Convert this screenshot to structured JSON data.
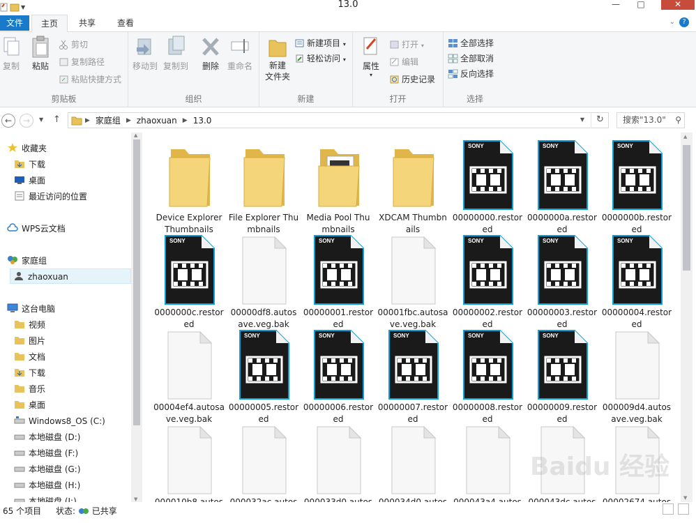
{
  "window": {
    "title": "13.0"
  },
  "tabs": [
    {
      "label": "文件"
    },
    {
      "label": "主页"
    },
    {
      "label": "共享"
    },
    {
      "label": "查看"
    }
  ],
  "ribbon": {
    "clipboard": {
      "label": "剪贴板",
      "copy": "复制",
      "paste": "粘贴",
      "cut": "剪切",
      "copy_path": "复制路径",
      "paste_shortcut": "粘贴快捷方式"
    },
    "organize": {
      "label": "组织",
      "move_to": "移动到",
      "copy_to": "复制到",
      "delete": "删除",
      "rename": "重命名"
    },
    "new": {
      "label": "新建",
      "new_folder": "新建\n文件夹",
      "new_item": "新建项目",
      "easy_access": "轻松访问"
    },
    "open": {
      "label": "打开",
      "properties": "属性",
      "open": "打开",
      "edit": "编辑",
      "history": "历史记录"
    },
    "select": {
      "label": "选择",
      "select_all": "全部选择",
      "select_none": "全部取消",
      "invert": "反向选择"
    }
  },
  "address": {
    "crumbs": [
      "家庭组",
      "zhaoxuan",
      "13.0"
    ],
    "search_placeholder": "搜索\"13.0\""
  },
  "nav": {
    "items": [
      {
        "label": "收藏夹",
        "icon": "star-icon"
      },
      {
        "label": "下载",
        "icon": "folder-download-icon"
      },
      {
        "label": "桌面",
        "icon": "desktop-icon"
      },
      {
        "label": "最近访问的位置",
        "icon": "recent-icon"
      },
      {
        "label": "WPS云文档",
        "icon": "cloud-icon"
      },
      {
        "label": "家庭组",
        "icon": "homegroup-icon"
      },
      {
        "label": "zhaoxuan",
        "icon": "user-icon"
      },
      {
        "label": "这台电脑",
        "icon": "computer-icon"
      },
      {
        "label": "视频",
        "icon": "folder-icon"
      },
      {
        "label": "图片",
        "icon": "folder-icon"
      },
      {
        "label": "文档",
        "icon": "folder-icon"
      },
      {
        "label": "下载",
        "icon": "folder-download-icon"
      },
      {
        "label": "音乐",
        "icon": "folder-icon"
      },
      {
        "label": "桌面",
        "icon": "folder-icon"
      },
      {
        "label": "Windows8_OS (C:)",
        "icon": "drive-icon"
      },
      {
        "label": "本地磁盘 (D:)",
        "icon": "drive-icon"
      },
      {
        "label": "本地磁盘 (F:)",
        "icon": "drive-icon"
      },
      {
        "label": "本地磁盘 (G:)",
        "icon": "drive-icon"
      },
      {
        "label": "本地磁盘 (H:)",
        "icon": "drive-icon"
      },
      {
        "label": "本地磁盘 (I:)",
        "icon": "drive-icon"
      }
    ]
  },
  "files": [
    {
      "name": "Device Explorer Thumbnails",
      "type": "folder"
    },
    {
      "name": "File Explorer Thumbnails",
      "type": "folder"
    },
    {
      "name": "Media Pool Thumbnails",
      "type": "folder-media"
    },
    {
      "name": "XDCAM Thumbnails",
      "type": "folder"
    },
    {
      "name": "00000000.restored",
      "type": "sony"
    },
    {
      "name": "0000000a.restored",
      "type": "sony"
    },
    {
      "name": "0000000b.restored",
      "type": "sony"
    },
    {
      "name": "0000000c.restored",
      "type": "sony"
    },
    {
      "name": "00000df8.autosave.veg.bak",
      "type": "blank"
    },
    {
      "name": "00000001.restored",
      "type": "sony"
    },
    {
      "name": "00001fbc.autosave.veg.bak",
      "type": "blank"
    },
    {
      "name": "00000002.restored",
      "type": "sony"
    },
    {
      "name": "00000003.restored",
      "type": "sony"
    },
    {
      "name": "00000004.restored",
      "type": "sony"
    },
    {
      "name": "00004ef4.autosave.veg.bak",
      "type": "blank"
    },
    {
      "name": "00000005.restored",
      "type": "sony"
    },
    {
      "name": "00000006.restored",
      "type": "sony"
    },
    {
      "name": "00000007.restored",
      "type": "sony"
    },
    {
      "name": "00000008.restored",
      "type": "sony"
    },
    {
      "name": "00000009.restored",
      "type": "sony"
    },
    {
      "name": "000009d4.autosave.veg.bak",
      "type": "blank"
    },
    {
      "name": "000010b8.autos",
      "type": "blank"
    },
    {
      "name": "000032ac.autos",
      "type": "blank"
    },
    {
      "name": "000033d0.autos",
      "type": "blank"
    },
    {
      "name": "000034d0.autos",
      "type": "blank"
    },
    {
      "name": "000043a4.autos",
      "type": "blank"
    },
    {
      "name": "000043dc.autos",
      "type": "blank"
    },
    {
      "name": "00002674.autos",
      "type": "blank"
    }
  ],
  "status": {
    "count": "65 个项目",
    "state_label": "状态:",
    "state_value": "已共享"
  },
  "watermark": "Baidu 经验"
}
